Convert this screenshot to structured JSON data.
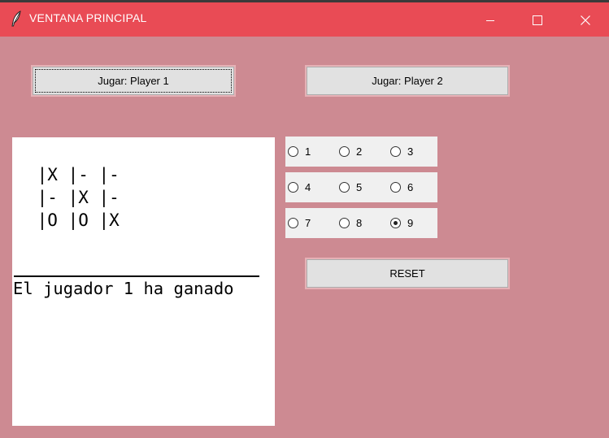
{
  "window": {
    "title": "VENTANA PRINCIPAL"
  },
  "buttons": {
    "player1": "Jugar: Player 1",
    "player2": "Jugar: Player 2",
    "reset": "RESET"
  },
  "board": {
    "lines": [
      " |X |- |-",
      " |- |X |-",
      " |O |O |X"
    ],
    "result": "El jugador 1 ha ganado"
  },
  "radios": [
    {
      "label": "1",
      "checked": false
    },
    {
      "label": "2",
      "checked": false
    },
    {
      "label": "3",
      "checked": false
    },
    {
      "label": "4",
      "checked": false
    },
    {
      "label": "5",
      "checked": false
    },
    {
      "label": "6",
      "checked": false
    },
    {
      "label": "7",
      "checked": false
    },
    {
      "label": "8",
      "checked": false
    },
    {
      "label": "9",
      "checked": true
    }
  ],
  "colors": {
    "titlebar": "#e94b55",
    "window_bg": "#cd8a92",
    "panel_bg": "#f0f0f0"
  }
}
